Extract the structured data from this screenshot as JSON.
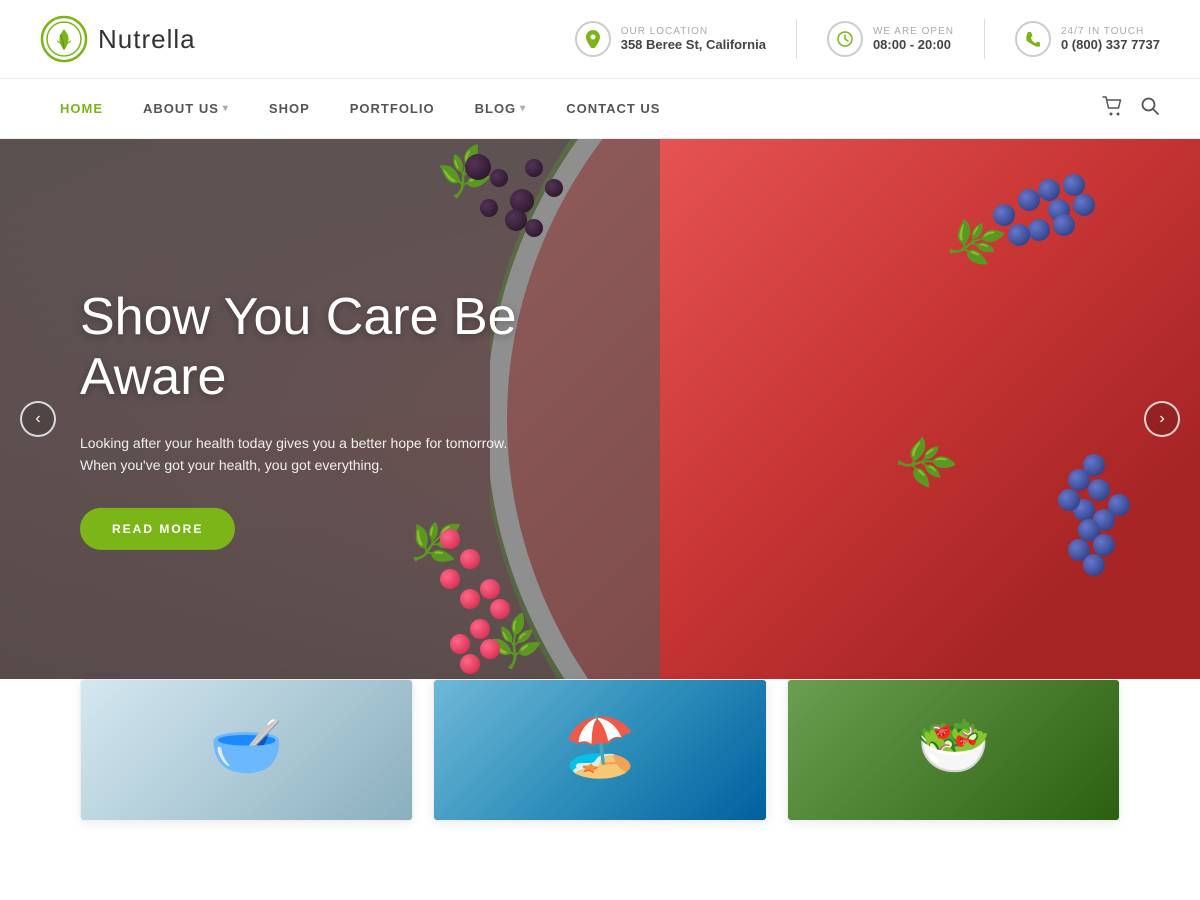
{
  "site": {
    "logo_text": "Nutrella",
    "logo_icon": "leaf-circle"
  },
  "header": {
    "location_label": "OUR LOCATION",
    "location_value": "358 Beree St, California",
    "hours_label": "WE ARE OPEN",
    "hours_value": "08:00 - 20:00",
    "phone_label": "24/7 IN TOUCH",
    "phone_value": "0 (800) 337 7737"
  },
  "nav": {
    "items": [
      {
        "label": "HOME",
        "active": true,
        "has_dropdown": false
      },
      {
        "label": "ABOUT US",
        "active": false,
        "has_dropdown": true
      },
      {
        "label": "SHOP",
        "active": false,
        "has_dropdown": false
      },
      {
        "label": "PORTFOLIO",
        "active": false,
        "has_dropdown": false
      },
      {
        "label": "BLOG",
        "active": false,
        "has_dropdown": true
      },
      {
        "label": "CONTACT US",
        "active": false,
        "has_dropdown": false
      }
    ],
    "cart_icon": "🛒",
    "search_icon": "🔍"
  },
  "hero": {
    "title": "Show You Care Be Aware",
    "subtitle": "Looking after your health today gives you a better hope for tomorrow.\nWhen you've got your health, you got everything.",
    "cta_label": "READ MORE",
    "prev_arrow": "‹",
    "next_arrow": "›"
  },
  "cards": [
    {
      "id": "card-1",
      "image_alt": "Bowl with fruits and oats"
    },
    {
      "id": "card-2",
      "image_alt": "Woman at beach"
    },
    {
      "id": "card-3",
      "image_alt": "Salad bowls overhead view"
    }
  ]
}
